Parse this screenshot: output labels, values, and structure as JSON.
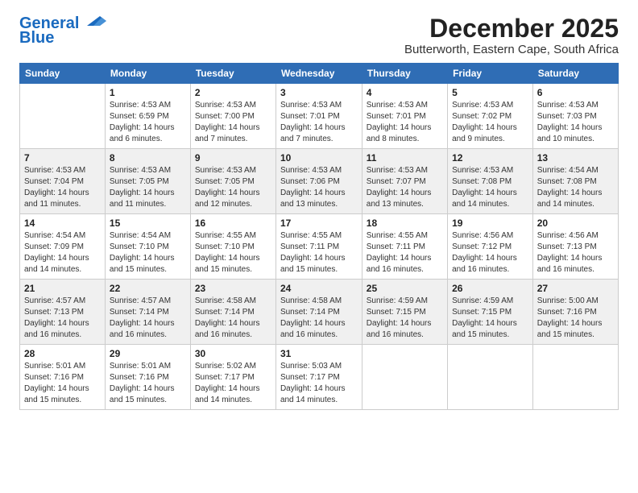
{
  "logo": {
    "line1": "General",
    "line2": "Blue"
  },
  "title": "December 2025",
  "location": "Butterworth, Eastern Cape, South Africa",
  "weekdays": [
    "Sunday",
    "Monday",
    "Tuesday",
    "Wednesday",
    "Thursday",
    "Friday",
    "Saturday"
  ],
  "weeks": [
    [
      {
        "day": "",
        "info": ""
      },
      {
        "day": "1",
        "info": "Sunrise: 4:53 AM\nSunset: 6:59 PM\nDaylight: 14 hours\nand 6 minutes."
      },
      {
        "day": "2",
        "info": "Sunrise: 4:53 AM\nSunset: 7:00 PM\nDaylight: 14 hours\nand 7 minutes."
      },
      {
        "day": "3",
        "info": "Sunrise: 4:53 AM\nSunset: 7:01 PM\nDaylight: 14 hours\nand 7 minutes."
      },
      {
        "day": "4",
        "info": "Sunrise: 4:53 AM\nSunset: 7:01 PM\nDaylight: 14 hours\nand 8 minutes."
      },
      {
        "day": "5",
        "info": "Sunrise: 4:53 AM\nSunset: 7:02 PM\nDaylight: 14 hours\nand 9 minutes."
      },
      {
        "day": "6",
        "info": "Sunrise: 4:53 AM\nSunset: 7:03 PM\nDaylight: 14 hours\nand 10 minutes."
      }
    ],
    [
      {
        "day": "7",
        "info": "Sunrise: 4:53 AM\nSunset: 7:04 PM\nDaylight: 14 hours\nand 11 minutes."
      },
      {
        "day": "8",
        "info": "Sunrise: 4:53 AM\nSunset: 7:05 PM\nDaylight: 14 hours\nand 11 minutes."
      },
      {
        "day": "9",
        "info": "Sunrise: 4:53 AM\nSunset: 7:05 PM\nDaylight: 14 hours\nand 12 minutes."
      },
      {
        "day": "10",
        "info": "Sunrise: 4:53 AM\nSunset: 7:06 PM\nDaylight: 14 hours\nand 13 minutes."
      },
      {
        "day": "11",
        "info": "Sunrise: 4:53 AM\nSunset: 7:07 PM\nDaylight: 14 hours\nand 13 minutes."
      },
      {
        "day": "12",
        "info": "Sunrise: 4:53 AM\nSunset: 7:08 PM\nDaylight: 14 hours\nand 14 minutes."
      },
      {
        "day": "13",
        "info": "Sunrise: 4:54 AM\nSunset: 7:08 PM\nDaylight: 14 hours\nand 14 minutes."
      }
    ],
    [
      {
        "day": "14",
        "info": "Sunrise: 4:54 AM\nSunset: 7:09 PM\nDaylight: 14 hours\nand 14 minutes."
      },
      {
        "day": "15",
        "info": "Sunrise: 4:54 AM\nSunset: 7:10 PM\nDaylight: 14 hours\nand 15 minutes."
      },
      {
        "day": "16",
        "info": "Sunrise: 4:55 AM\nSunset: 7:10 PM\nDaylight: 14 hours\nand 15 minutes."
      },
      {
        "day": "17",
        "info": "Sunrise: 4:55 AM\nSunset: 7:11 PM\nDaylight: 14 hours\nand 15 minutes."
      },
      {
        "day": "18",
        "info": "Sunrise: 4:55 AM\nSunset: 7:11 PM\nDaylight: 14 hours\nand 16 minutes."
      },
      {
        "day": "19",
        "info": "Sunrise: 4:56 AM\nSunset: 7:12 PM\nDaylight: 14 hours\nand 16 minutes."
      },
      {
        "day": "20",
        "info": "Sunrise: 4:56 AM\nSunset: 7:13 PM\nDaylight: 14 hours\nand 16 minutes."
      }
    ],
    [
      {
        "day": "21",
        "info": "Sunrise: 4:57 AM\nSunset: 7:13 PM\nDaylight: 14 hours\nand 16 minutes."
      },
      {
        "day": "22",
        "info": "Sunrise: 4:57 AM\nSunset: 7:14 PM\nDaylight: 14 hours\nand 16 minutes."
      },
      {
        "day": "23",
        "info": "Sunrise: 4:58 AM\nSunset: 7:14 PM\nDaylight: 14 hours\nand 16 minutes."
      },
      {
        "day": "24",
        "info": "Sunrise: 4:58 AM\nSunset: 7:14 PM\nDaylight: 14 hours\nand 16 minutes."
      },
      {
        "day": "25",
        "info": "Sunrise: 4:59 AM\nSunset: 7:15 PM\nDaylight: 14 hours\nand 16 minutes."
      },
      {
        "day": "26",
        "info": "Sunrise: 4:59 AM\nSunset: 7:15 PM\nDaylight: 14 hours\nand 15 minutes."
      },
      {
        "day": "27",
        "info": "Sunrise: 5:00 AM\nSunset: 7:16 PM\nDaylight: 14 hours\nand 15 minutes."
      }
    ],
    [
      {
        "day": "28",
        "info": "Sunrise: 5:01 AM\nSunset: 7:16 PM\nDaylight: 14 hours\nand 15 minutes."
      },
      {
        "day": "29",
        "info": "Sunrise: 5:01 AM\nSunset: 7:16 PM\nDaylight: 14 hours\nand 15 minutes."
      },
      {
        "day": "30",
        "info": "Sunrise: 5:02 AM\nSunset: 7:17 PM\nDaylight: 14 hours\nand 14 minutes."
      },
      {
        "day": "31",
        "info": "Sunrise: 5:03 AM\nSunset: 7:17 PM\nDaylight: 14 hours\nand 14 minutes."
      },
      {
        "day": "",
        "info": ""
      },
      {
        "day": "",
        "info": ""
      },
      {
        "day": "",
        "info": ""
      }
    ]
  ]
}
